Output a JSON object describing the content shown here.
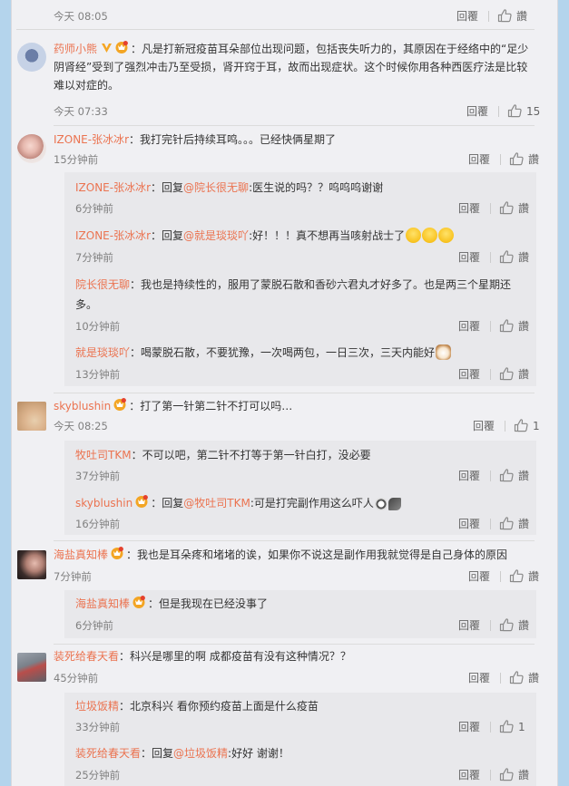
{
  "comments": [
    {
      "time": "今天 08:05",
      "reply_label": "回覆",
      "like_label": "讚"
    },
    {
      "user": "药师小熊",
      "text": "：凡是打新冠疫苗耳朵部位出现问题，包括丧失听力的，其原因在于经络中的“足少阴肾经”受到了强烈冲击乃至受损，肾开窍于耳，故而出现症状。这个时候你用各种西医疗法是比较难以对症的。",
      "time": "今天 07:33",
      "reply_label": "回覆",
      "likes": "15"
    },
    {
      "user": "IZONE-张冰冰r",
      "text": "：我打完针后持续耳鸣。。。已经快俩星期了",
      "time": "15分钟前",
      "reply_label": "回覆",
      "like_label": "讚",
      "replies": [
        {
          "user": "IZONE-张冰冰r",
          "prefix": "：回复",
          "at": "@院长很无聊",
          "text": ":医生说的吗？？呜呜呜谢谢",
          "time": "6分钟前",
          "reply_label": "回覆",
          "like_label": "讚"
        },
        {
          "user": "IZONE-张冰冰r",
          "prefix": "：回复",
          "at": "@就是琰琰吖",
          "text": ":好！！！真不想再当咳射战士了",
          "time": "7分钟前",
          "reply_label": "回覆",
          "like_label": "讚"
        },
        {
          "user": "院长很无聊",
          "text": "：我也是持续性的，服用了蒙脱石散和香砂六君丸才好多了。也是两三个星期还多。",
          "time": "10分钟前",
          "reply_label": "回覆",
          "like_label": "讚"
        },
        {
          "user": "就是琰琰吖",
          "text": "：喝蒙脱石散，不要犹豫，一次喝两包，一日三次，三天内能好",
          "time": "13分钟前",
          "reply_label": "回覆",
          "like_label": "讚"
        }
      ]
    },
    {
      "user": "skyblushin",
      "text": "：打了第一针第二针不打可以吗…",
      "time": "今天 08:25",
      "reply_label": "回覆",
      "likes": "1",
      "replies": [
        {
          "user": "牧吐司TKM",
          "text": "：不可以吧，第二针不打等于第一针白打，没必要",
          "time": "37分钟前",
          "reply_label": "回覆",
          "like_label": "讚"
        },
        {
          "user": "skyblushin",
          "prefix": "：回复",
          "at": "@牧吐司TKM",
          "text": ":可是打完副作用这么吓人",
          "time": "16分钟前",
          "reply_label": "回覆",
          "like_label": "讚"
        }
      ]
    },
    {
      "user": "海盐真知棒",
      "text": "：我也是耳朵疼和堵堵的诶，如果你不说这是副作用我就觉得是自己身体的原因",
      "time": "7分钟前",
      "reply_label": "回覆",
      "like_label": "讚",
      "replies": [
        {
          "user": "海盐真知棒",
          "text": "：但是我现在已经没事了",
          "time": "6分钟前",
          "reply_label": "回覆",
          "like_label": "讚"
        }
      ]
    },
    {
      "user": "装死给春天看",
      "text": "：科兴是哪里的啊 成都疫苗有没有这种情况？？",
      "time": "45分钟前",
      "reply_label": "回覆",
      "like_label": "讚",
      "replies": [
        {
          "user": "垃圾饭精",
          "text": "：北京科兴 看你预约疫苗上面是什么疫苗",
          "time": "33分钟前",
          "reply_label": "回覆",
          "likes": "1"
        },
        {
          "user": "装死给春天看",
          "prefix": "：回复",
          "at": "@垃圾饭精",
          "text": ":好好 谢谢！",
          "time": "25分钟前",
          "reply_label": "回覆",
          "like_label": "讚"
        }
      ]
    }
  ],
  "colors": {
    "username": "#eb7350",
    "page_bg": "#b4d4ec",
    "panel_bg": "#f0f0f3",
    "reply_bg": "#e8e8eb"
  }
}
